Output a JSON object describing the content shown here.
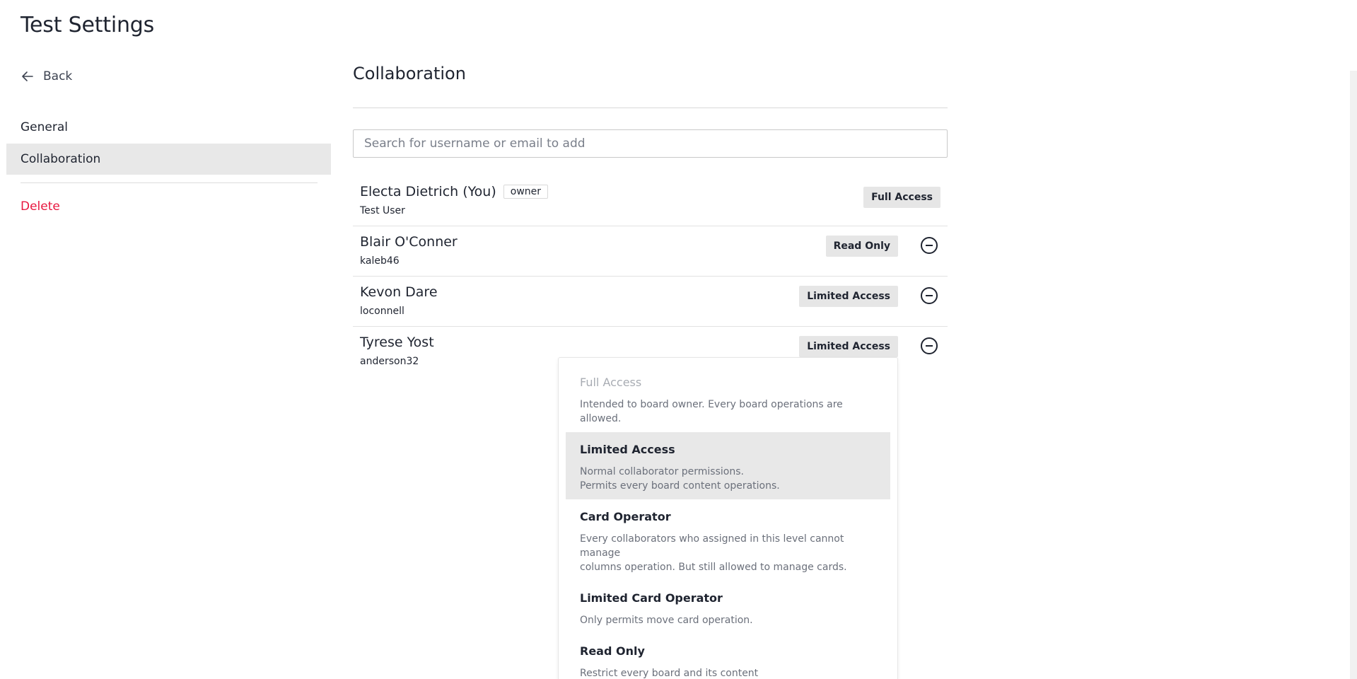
{
  "page": {
    "title": "Test Settings"
  },
  "sidebar": {
    "back_label": "Back",
    "items": [
      {
        "label": "General"
      },
      {
        "label": "Collaboration",
        "active": true
      }
    ],
    "delete_label": "Delete"
  },
  "main": {
    "section_title": "Collaboration",
    "search_placeholder": "Search for username or email to add",
    "members": [
      {
        "name": "Electa Dietrich",
        "you": "(You)",
        "badge": "owner",
        "username": "Test User",
        "role": "Full Access"
      },
      {
        "name": "Blair O'Conner",
        "username": "kaleb46",
        "role": "Read Only"
      },
      {
        "name": "Kevon Dare",
        "username": "loconnell",
        "role": "Limited Access"
      },
      {
        "name": "Tyrese Yost",
        "username": "anderson32",
        "role": "Limited Access"
      }
    ]
  },
  "dropdown": {
    "options": [
      {
        "title": "Full Access",
        "desc": "Intended to board owner. Every board operations are allowed.",
        "disabled": true
      },
      {
        "title": "Limited Access",
        "desc": "Normal collaborator permissions.\nPermits every board content operations.",
        "selected": true
      },
      {
        "title": "Card Operator",
        "desc": "Every collaborators who assigned in this level cannot manage\ncolumns operation. But still allowed to manage cards."
      },
      {
        "title": "Limited Card Operator",
        "desc": "Only permits move card operation."
      },
      {
        "title": "Read Only",
        "desc": "Restrict every board and its content\noperations but still can access the board."
      }
    ]
  },
  "colors": {
    "accent_danger": "#e8173f",
    "active_bg": "#e8e8e8",
    "button_bg": "#e6e6e6"
  },
  "icons": {
    "back": "arrow-left-icon",
    "remove": "minus-circle-icon"
  }
}
